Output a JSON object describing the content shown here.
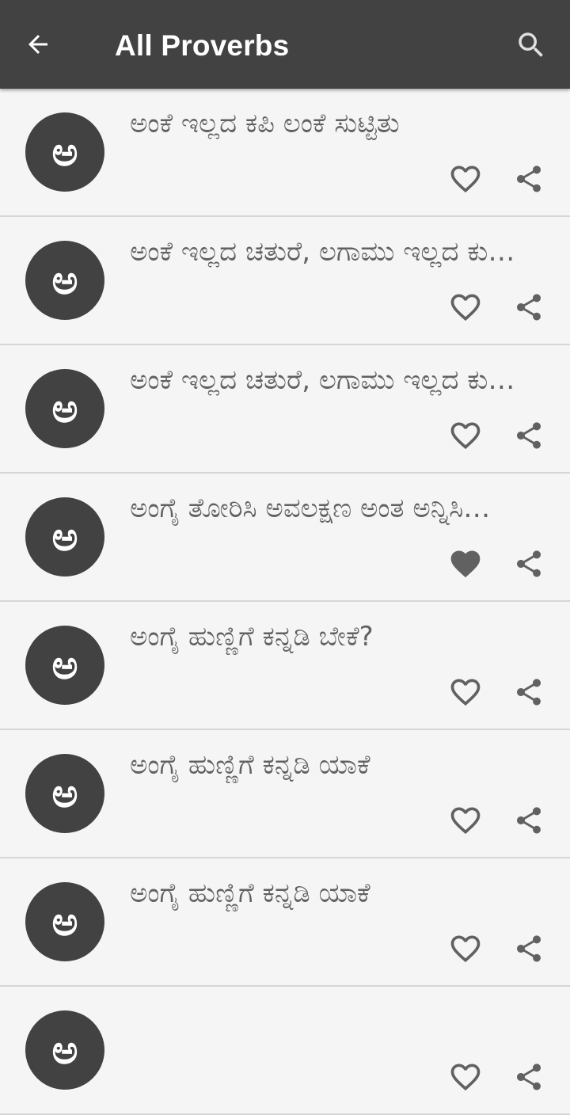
{
  "appbar": {
    "title": "All Proverbs",
    "back_icon": "arrow-back-icon",
    "search_icon": "search-icon",
    "background_color": "#424242"
  },
  "list": {
    "avatar_letter": "ಅ",
    "items": [
      {
        "text": "ಅಂಕೆ ಇಲ್ಲದ ಕಪಿ ಲಂಕೆ ಸುಟ್ಟಿತು",
        "favorite": false
      },
      {
        "text": "ಅಂಕೆ ಇಲ್ಲದ ಚತುರೆ, ಲಗಾಮು ಇಲ್ಲದ ಕುದುರೆ",
        "favorite": false
      },
      {
        "text": "ಅಂಕೆ ಇಲ್ಲದ ಚತುರೆ, ಲಗಾಮು ಇಲ್ಲದ ಕುದುರೆ",
        "favorite": false
      },
      {
        "text": "ಅಂಗೈ ತೋರಿಸಿ ಅವಲಕ್ಷಣ ಅಂತ ಅನ್ನಿಸಿಕೊಂಡರು",
        "favorite": true
      },
      {
        "text": "ಅಂಗೈ ಹುಣ್ಣಿಗೆ ಕನ್ನಡಿ ಬೇಕೆ?",
        "favorite": false
      },
      {
        "text": "ಅಂಗೈ ಹುಣ್ಣಿಗೆ ಕನ್ನಡಿ ಯಾಕೆ",
        "favorite": false
      },
      {
        "text": "ಅಂಗೈ ಹುಣ್ಣಿಗೆ ಕನ್ನಡಿ ಯಾಕೆ",
        "favorite": false
      },
      {
        "text": "",
        "favorite": false
      }
    ]
  },
  "colors": {
    "icon": "#616161",
    "text": "#616161",
    "divider": "#d6d6d6",
    "background": "#f5f5f5"
  }
}
